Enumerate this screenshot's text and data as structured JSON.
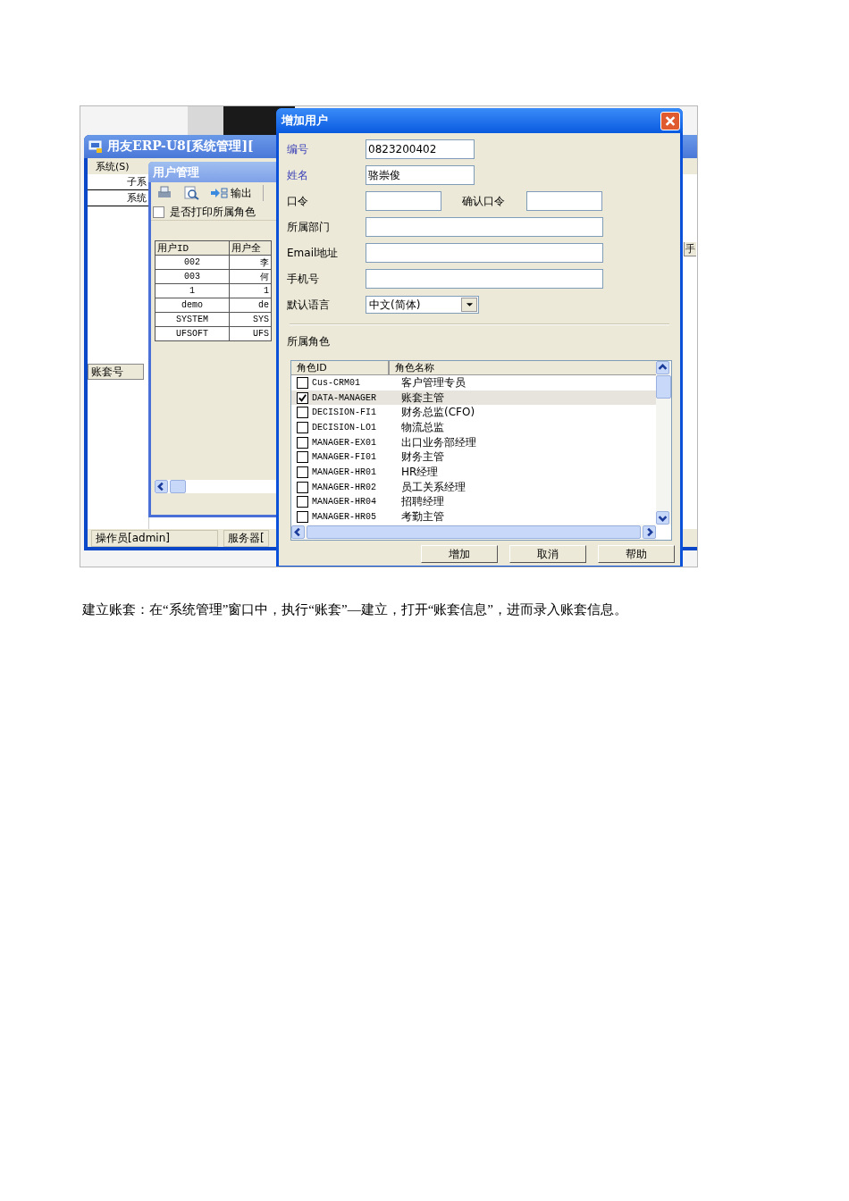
{
  "main_window": {
    "title": "用友ERP-U8[系统管理][",
    "menu": [
      "系统(S)"
    ],
    "rows": [
      "子系",
      "系统"
    ],
    "column_header": "账套号",
    "right_header": "手",
    "status": [
      "操作员[admin]",
      "服务器["
    ]
  },
  "user_window": {
    "title": "用户管理",
    "toolbar": [
      {
        "kind": "print"
      },
      {
        "kind": "preview"
      },
      {
        "kind": "export",
        "label": "输出"
      }
    ],
    "print_roles": {
      "label": "是否打印所属角色",
      "checked": false
    },
    "columns": [
      "用户ID",
      "用户全"
    ],
    "rows": [
      [
        "002",
        "李"
      ],
      [
        "003",
        "何"
      ],
      [
        "1",
        "1"
      ],
      [
        "demo",
        "de"
      ],
      [
        "SYSTEM",
        "SYS"
      ],
      [
        "UFSOFT",
        "UFS"
      ]
    ]
  },
  "dialog": {
    "title": "增加用户",
    "fields": [
      {
        "kind": "short_text",
        "label": "编号",
        "value": "0823200402",
        "required": true
      },
      {
        "kind": "short_text",
        "label": "姓名",
        "value": "骆崇俊",
        "required": true
      },
      {
        "kind": "password_pair",
        "label": "口令",
        "confirm_label": "确认口令",
        "required": false
      },
      {
        "kind": "text",
        "label": "所属部门",
        "required": false
      },
      {
        "kind": "text",
        "label": "Email地址",
        "required": false
      },
      {
        "kind": "text",
        "label": "手机号",
        "required": false
      },
      {
        "kind": "select",
        "label": "默认语言",
        "value": "中文(简体)",
        "required": false
      }
    ],
    "roles_label": "所属角色",
    "role_columns": [
      "角色ID",
      "角色名称"
    ],
    "roles": [
      {
        "id": "Cus-CRM01",
        "name": "客户管理专员",
        "checked": false,
        "selected": false
      },
      {
        "id": "DATA-MANAGER",
        "name": "账套主管",
        "checked": true,
        "selected": true
      },
      {
        "id": "DECISION-FI1",
        "name": "财务总监(CFO)",
        "checked": false,
        "selected": false
      },
      {
        "id": "DECISION-LO1",
        "name": "物流总监",
        "checked": false,
        "selected": false
      },
      {
        "id": "MANAGER-EX01",
        "name": "出口业务部经理",
        "checked": false,
        "selected": false
      },
      {
        "id": "MANAGER-FI01",
        "name": "财务主管",
        "checked": false,
        "selected": false
      },
      {
        "id": "MANAGER-HR01",
        "name": "HR经理",
        "checked": false,
        "selected": false
      },
      {
        "id": "MANAGER-HR02",
        "name": "员工关系经理",
        "checked": false,
        "selected": false
      },
      {
        "id": "MANAGER-HR04",
        "name": "招聘经理",
        "checked": false,
        "selected": false
      },
      {
        "id": "MANAGER-HR05",
        "name": "考勤主管",
        "checked": false,
        "selected": false
      }
    ],
    "buttons": [
      "增加",
      "取消",
      "帮助"
    ]
  },
  "caption": "建立账套：在“系统管理”窗口中，执行“账套”—建立，打开“账套信息”，进而录入账套信息。"
}
